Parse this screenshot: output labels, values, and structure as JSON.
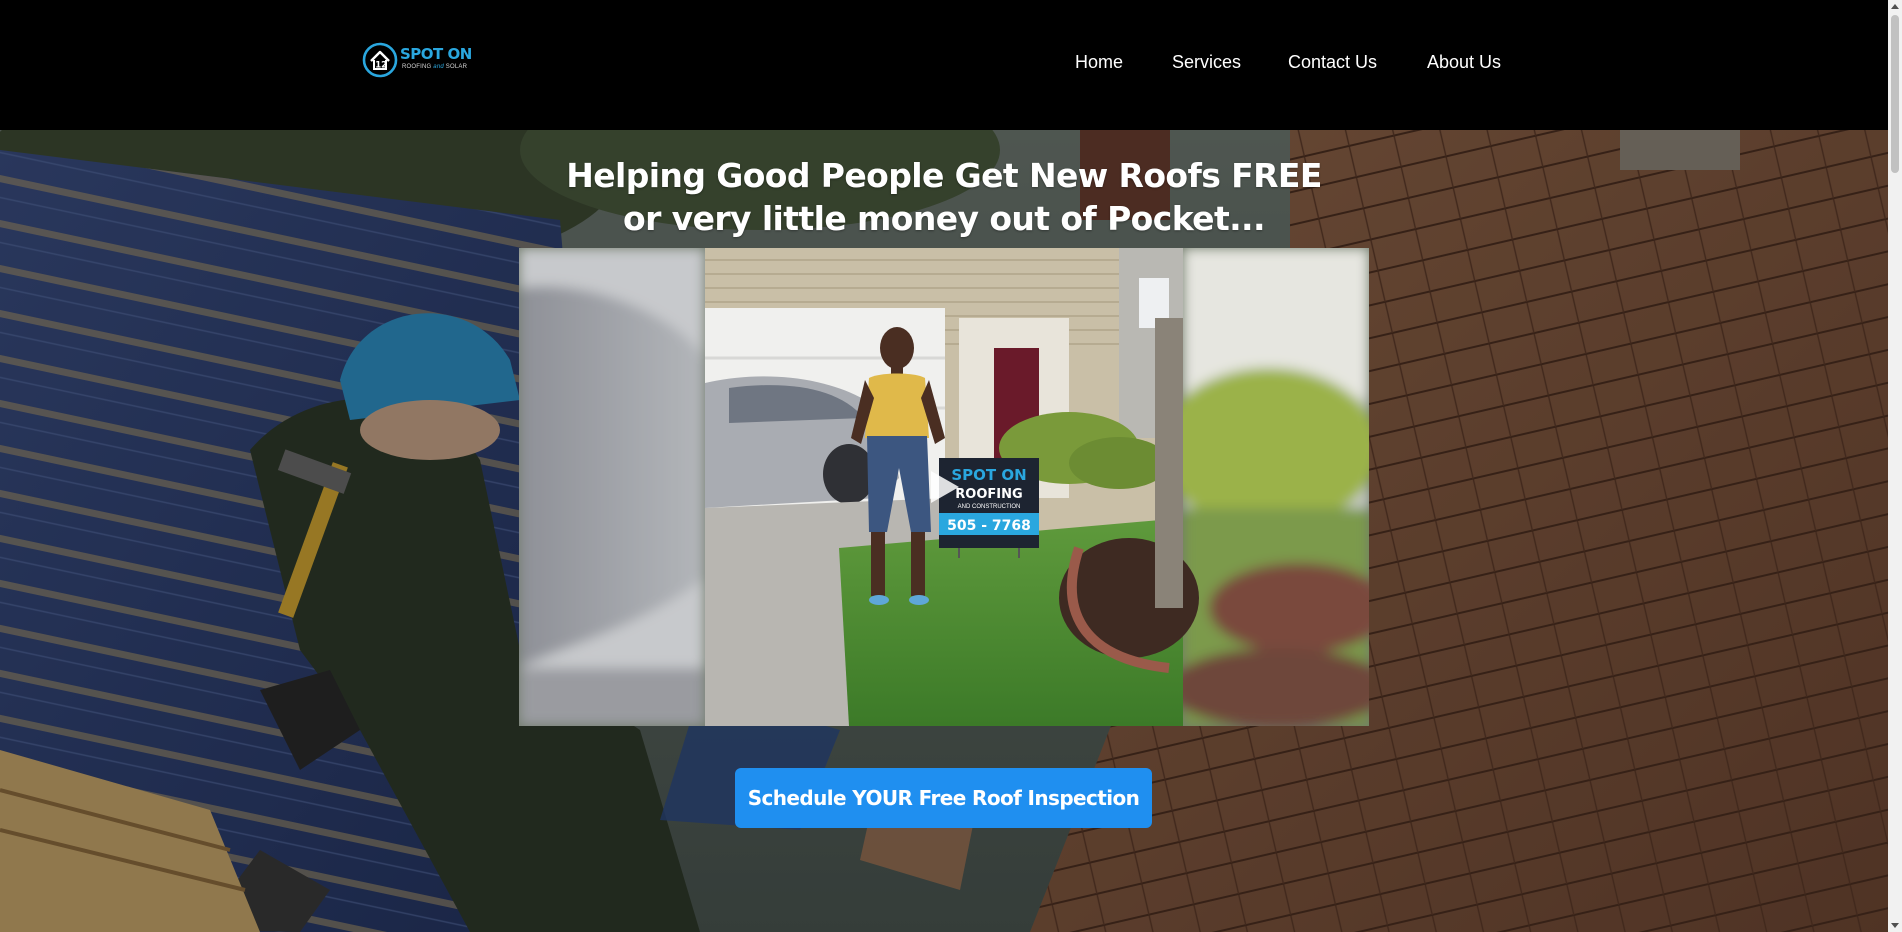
{
  "logo": {
    "title": "SPOT ON",
    "subtitle_pre": "ROOFING",
    "subtitle_and": "and",
    "subtitle_post": "SOLAR"
  },
  "nav": {
    "items": [
      {
        "label": "Home"
      },
      {
        "label": "Services"
      },
      {
        "label": "Contact Us"
      },
      {
        "label": "About Us"
      }
    ]
  },
  "hero": {
    "heading_line1": "Helping Good People Get New Roofs FREE",
    "heading_line2": "or very little money out of Pocket...",
    "video": {
      "sign_title": "SPOT ON",
      "sign_line2": "ROOFING",
      "sign_line3": "AND CONSTRUCTION",
      "sign_phone": "505 - 7768"
    },
    "cta_label": "Schedule YOUR Free Roof Inspection"
  },
  "colors": {
    "header_bg": "#000000",
    "accent": "#1f8ff0",
    "logo_blue": "#2aa7df",
    "text": "#ffffff"
  },
  "icons": {
    "logo": "house-12-logo-icon",
    "play": "play-icon",
    "scroll_up": "chevron-up-icon",
    "scroll_down": "chevron-down-icon"
  }
}
